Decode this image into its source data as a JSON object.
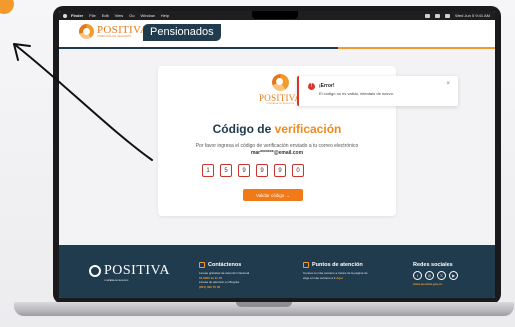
{
  "menubar": {
    "items": [
      "Finder",
      "File",
      "Edit",
      "View",
      "Go",
      "Window",
      "Help"
    ],
    "datetime": "Wed Jun 5 9:41 AM"
  },
  "header": {
    "brand": "POSITIVA",
    "brand_tagline": "COMPAÑÍA DE SEGUROS",
    "portal_title": "Pensionados"
  },
  "toast": {
    "icon": "error-icon",
    "title": "¡Error!",
    "message": "El código no es valido, intentalo de nuevo.",
    "close": "×"
  },
  "card": {
    "logo_word": "POSITIVA",
    "logo_tag": "COMPAÑÍA DE SEGUROS",
    "title_prefix": "Código de",
    "title_accent": "verificación",
    "description": "Por favor ingresa el código de verificación enviado a tu correo electrónico",
    "email": "mar*******@email.com",
    "code_digits": [
      "1",
      "5",
      "9",
      "9",
      "9",
      "0"
    ],
    "button_label": "Validar código  →"
  },
  "footer": {
    "brand": "POSITIVA",
    "brand_tag": "COMPAÑÍA DE SEGUROS",
    "contact": {
      "heading": "Contáctenos",
      "line1": "Líneas gratuitas de atención Nacional",
      "line1_value": "01 8000 11 11 70",
      "line2": "Líneas de atención en Bogotá",
      "line2_value": "(601) 330 70 00"
    },
    "attention": {
      "heading": "Puntos de atención",
      "line1": "Conoce tu más cercano a través de la página de",
      "line2": "elige el más cercano a ti",
      "link": "Aquí"
    },
    "social": {
      "heading": "Redes sociales",
      "icons": [
        "f",
        "◎",
        "𝕏",
        "▶"
      ],
      "site": "www.positiva.gov.co"
    }
  },
  "colors": {
    "brand_orange": "#f08a1c",
    "brand_navy": "#213b4e",
    "error_red": "#d9352c"
  }
}
